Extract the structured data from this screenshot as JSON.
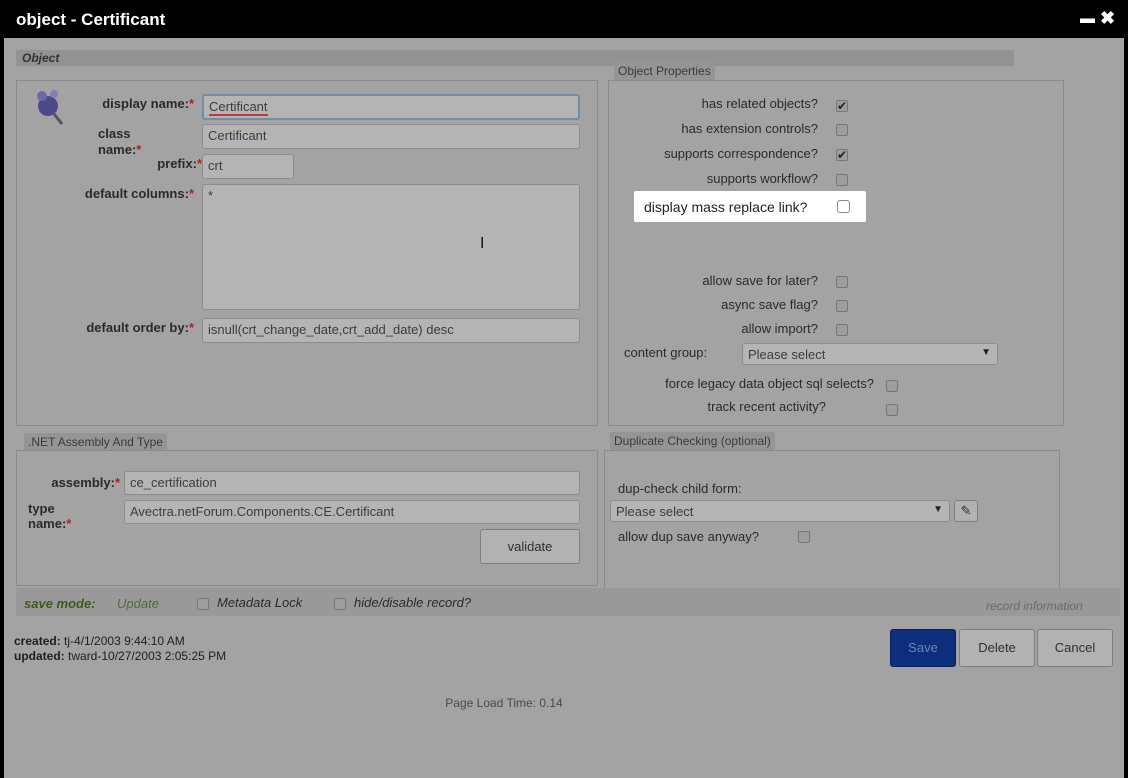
{
  "window": {
    "title": "object - Certificant",
    "minimize_glyph": "▬",
    "close_glyph": "✖"
  },
  "object_section": {
    "header": "Object",
    "display_name_label": "display name:",
    "display_name_value": "Certificant",
    "class_name_label_1": "class",
    "class_name_label_2": "name:",
    "class_name_value": "Certificant",
    "prefix_label": "prefix:",
    "prefix_value": "crt",
    "default_columns_label": "default columns:",
    "default_columns_value": "*",
    "default_order_by_label": "default order by:",
    "default_order_by_value": "isnull(crt_change_date,crt_add_date) desc",
    "required_marker": "*"
  },
  "object_properties": {
    "header": "Object Properties",
    "items": [
      {
        "label": "has related objects?",
        "checked": true
      },
      {
        "label": "has extension controls?",
        "checked": false
      },
      {
        "label": "supports correspondence?",
        "checked": true
      },
      {
        "label": "supports workflow?",
        "checked": false
      },
      {
        "label": "display mass replace link?",
        "checked": false
      },
      {
        "label": "allow save for later?",
        "checked": false
      },
      {
        "label": "async save flag?",
        "checked": false
      },
      {
        "label": "allow import?",
        "checked": false
      }
    ],
    "content_group_label": "content group:",
    "content_group_value": "Please select",
    "force_legacy_label": "force legacy data object sql selects?",
    "track_recent_label": "track recent activity?",
    "check_glyph": "✔",
    "dropdown_glyph": "▼"
  },
  "assembly_section": {
    "header": ".NET Assembly And Type",
    "assembly_label": "assembly:",
    "assembly_value": "ce_certification",
    "type_name_label_1": "type",
    "type_name_label_2": "name:",
    "type_name_value": "Avectra.netForum.Components.CE.Certificant",
    "validate_button": "validate"
  },
  "duplicate_section": {
    "header": "Duplicate Checking (optional)",
    "dup_child_form_label": "dup-check child form:",
    "dup_child_form_value": "Please select",
    "allow_dup_label": "allow dup save anyway?",
    "edit_glyph": "✎"
  },
  "status_bar": {
    "save_mode_label": "save mode:",
    "save_mode_value": "Update",
    "metadata_lock_label": "Metadata Lock",
    "hide_disable_label": "hide/disable record?",
    "record_information": "record information"
  },
  "footer": {
    "created_label": "created:",
    "created_value": "tj-4/1/2003 9:44:10 AM",
    "updated_label": "updated:",
    "updated_value": "tward-10/27/2003 2:05:25 PM",
    "save_button": "Save",
    "delete_button": "Delete",
    "cancel_button": "Cancel",
    "page_load_time": "Page Load Time: 0.14"
  },
  "cursor_glyph": "I"
}
